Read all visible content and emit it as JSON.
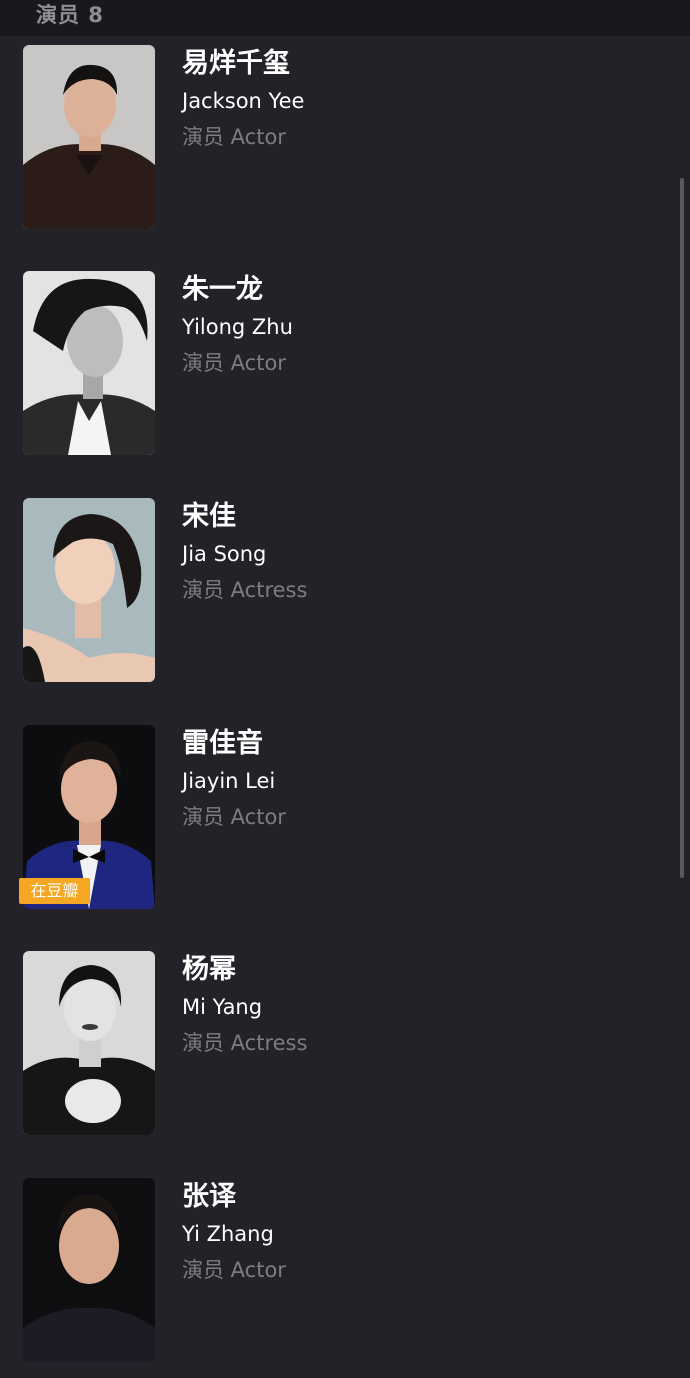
{
  "header": {
    "title": "演员 8"
  },
  "cast": [
    {
      "name_zh": "易烊千玺",
      "name_en": "Jackson Yee",
      "role": "演员 Actor",
      "photo_icon": "portrait-photo"
    },
    {
      "name_zh": "朱一龙",
      "name_en": "Yilong Zhu",
      "role": "演员 Actor",
      "photo_icon": "portrait-photo"
    },
    {
      "name_zh": "宋佳",
      "name_en": "Jia Song",
      "role": "演员 Actress",
      "photo_icon": "portrait-photo"
    },
    {
      "name_zh": "雷佳音",
      "name_en": "Jiayin Lei",
      "role": "演员 Actor",
      "photo_icon": "portrait-photo",
      "badge": "在豆瓣"
    },
    {
      "name_zh": "杨幂",
      "name_en": "Mi Yang",
      "role": "演员 Actress",
      "photo_icon": "portrait-photo"
    },
    {
      "name_zh": "张译",
      "name_en": "Yi Zhang",
      "role": "演员 Actor",
      "photo_icon": "portrait-photo"
    }
  ],
  "colors": {
    "background": "#232229",
    "header_bg": "#19191d",
    "name": "#ffffff",
    "role": "#7d7c82",
    "badge": "#f5a623"
  }
}
